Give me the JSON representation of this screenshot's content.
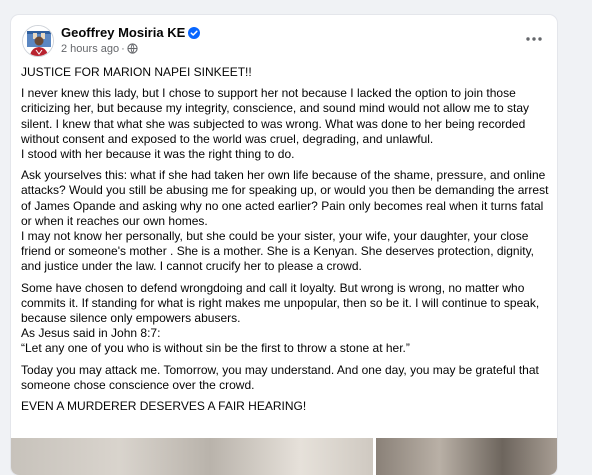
{
  "post": {
    "author": "Geoffrey Mosiria KE",
    "time": "2 hours ago",
    "separator": "·",
    "paragraphs": [
      "JUSTICE FOR MARION NAPEI SINKEET!!",
      "I never knew this lady, but I chose to support her not because I lacked the option to join those criticizing her, but because my integrity, conscience, and sound mind would not allow me to stay silent. I knew that what she was subjected to was wrong. What was done to her being recorded without consent and exposed to the world was cruel, degrading, and unlawful.\nI stood with her because it was the right thing to do.",
      "Ask yourselves this: what if she had taken her own life because of the shame, pressure, and online attacks? Would you still be abusing me for speaking up, or would you then be demanding the arrest of James Opande and asking why no one acted earlier? Pain only becomes real when it turns fatal or when it reaches our own homes.\nI may not know her personally, but she could be your sister, your wife, your daughter, your close friend or someone's mother . She is a mother. She is a Kenyan. She deserves protection, dignity, and justice under the law. I cannot crucify her to please a crowd.",
      "Some have chosen to defend wrongdoing and call it loyalty. But wrong is wrong, no matter who commits it. If standing for what is right makes me unpopular, then so be it. I will continue to speak, because silence only empowers abusers.\nAs Jesus said in John 8:7:\n“Let any one of you who is without sin be the first to throw a stone at her.”",
      "Today you may attack me. Tomorrow, you may understand. And one day, you may be grateful that someone chose conscience over the crowd.",
      "EVEN A MURDERER DESERVES A FAIR HEARING!"
    ]
  },
  "colors": {
    "verified": "#0866ff",
    "meta_text": "#65676b",
    "body_text": "#050505",
    "page_bg": "#f0f2f5"
  },
  "icons": {
    "verified": "verified-badge-icon",
    "audience": "globe-icon",
    "more": "more-options-icon"
  }
}
